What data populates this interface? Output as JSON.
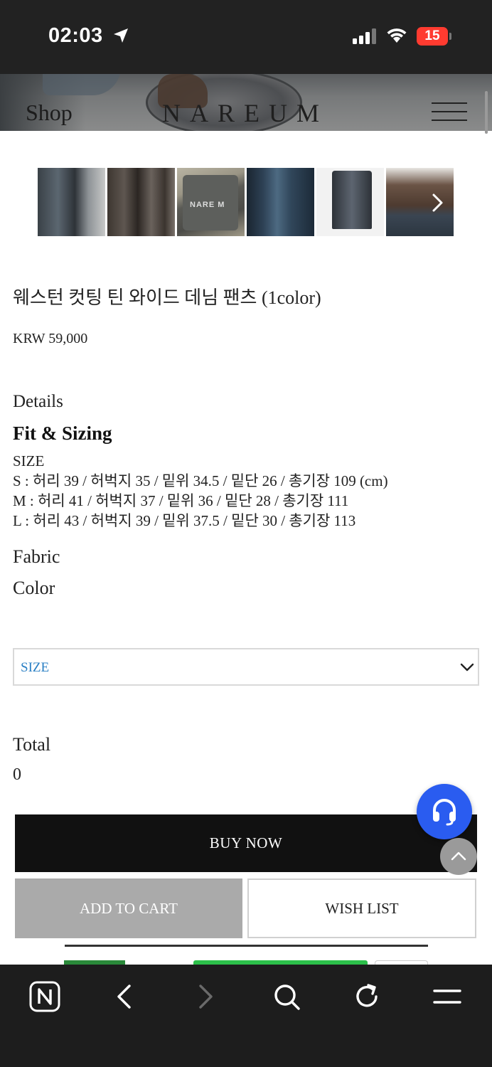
{
  "status_bar": {
    "time": "02:03",
    "battery": "15"
  },
  "header": {
    "shop_label": "Shop",
    "logo": "NAREUM"
  },
  "gallery": {
    "thumbnails": [
      "thumb-1",
      "thumb-2",
      "thumb-3",
      "thumb-4",
      "thumb-5",
      "thumb-6"
    ],
    "bag_print": "NARE M"
  },
  "product": {
    "title": "웨스턴 컷팅 틴 와이드 데님 팬츠 (1color)",
    "price": "KRW 59,000"
  },
  "details": {
    "heading": "Details",
    "fit_heading": "Fit & Sizing",
    "size_lines": [
      "SIZE",
      "S : 허리 39 / 허벅지 35 / 밑위 34.5 / 밑단 26 / 총기장 109 (cm)",
      "M : 허리 41 / 허벅지 37 / 밑위 36 / 밑단 28 / 총기장 111",
      "L : 허리 43 / 허벅지 39 / 밑위 37.5 / 밑단 30 / 총기장 113"
    ],
    "fabric_heading": "Fabric",
    "color_heading": "Color"
  },
  "size_select": {
    "label": "SIZE"
  },
  "total": {
    "label": "Total",
    "value": "0"
  },
  "actions": {
    "buy_now": "BUY NOW",
    "add_to_cart": "ADD TO CART",
    "wish_list": "WISH LIST"
  },
  "icons": {
    "location": "location-arrow-icon",
    "signal": "cellular-signal-icon",
    "wifi": "wifi-icon",
    "menu": "hamburger-menu-icon",
    "next": "chevron-right-icon",
    "dropdown": "chevron-down-icon",
    "support": "headset-icon",
    "top": "chevron-up-icon",
    "naver": "naver-n-icon",
    "back": "chevron-left-icon",
    "forward": "chevron-right-icon",
    "search": "search-icon",
    "reload": "reload-icon",
    "browser_menu": "menu-icon"
  },
  "colors": {
    "accent_blue": "#2a5cf0",
    "select_label": "#2a7fc4",
    "buy_now_bg": "#111111",
    "cart_bg": "#aaaaaa",
    "battery_low": "#ff3b30"
  }
}
